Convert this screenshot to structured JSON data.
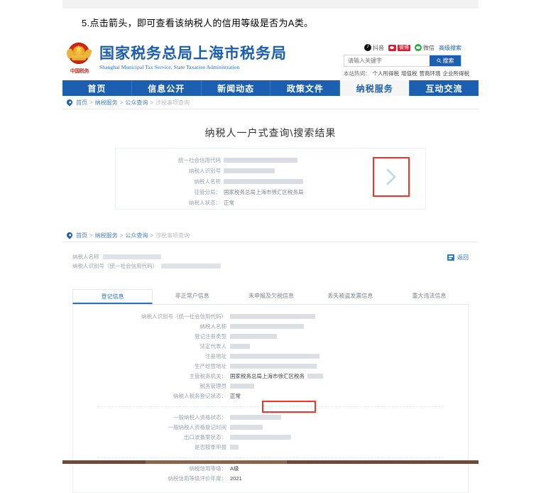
{
  "instruction": "5.点击箭头，即可查看该纳税人的信用等级是否为A类。",
  "site": {
    "title_cn": "国家税务总局上海市税务局",
    "title_en": "Shanghai Municipal Tax Service, State Taxation Administration",
    "emblem_mark": "中国税务"
  },
  "social": [
    {
      "label": "抖音",
      "icon": "douyin-icon"
    },
    {
      "label": "微博",
      "icon": "weibo-icon"
    },
    {
      "label": "微信",
      "icon": "weixin-icon"
    }
  ],
  "advanced_search": "高级搜索",
  "search": {
    "placeholder": "请输入关键字",
    "value": "",
    "button": "搜索",
    "icon": "search-icon"
  },
  "hotwords": {
    "prefix": "本站热词：",
    "items": [
      "个人所得税",
      "增值税",
      "营商环境",
      "企业所得税"
    ]
  },
  "nav": [
    {
      "label": "首页",
      "active": false
    },
    {
      "label": "信息公开",
      "active": false
    },
    {
      "label": "新闻动态",
      "active": false
    },
    {
      "label": "政策文件",
      "active": false
    },
    {
      "label": "纳税服务",
      "active": true
    },
    {
      "label": "互动交流",
      "active": false
    }
  ],
  "breadcrumb": {
    "items": [
      "首页",
      "纳税服务",
      "公众查询"
    ],
    "current": "涉税事项查询",
    "separator": ">"
  },
  "panel_a": {
    "card_title": "纳税人一户式查询\\搜索结果",
    "fields": [
      {
        "label": "统一社会信用代码",
        "value": "",
        "redacted": true,
        "redact_width": 104
      },
      {
        "label": "纳税人识别号",
        "value": "",
        "redacted": true,
        "redact_width": 72
      },
      {
        "label": "纳税人名称",
        "value": "",
        "redacted": true,
        "redact_width": 112
      },
      {
        "label": "征管分局：",
        "value": "国家税务总局上海市徐汇区税务局",
        "redacted": false
      },
      {
        "label": "纳税人状态：",
        "value": "正常",
        "redacted": false
      }
    ],
    "arrow_icon": "chevron-right-icon"
  },
  "panel_b": {
    "who": [
      {
        "label": "纳税人名称",
        "redact_width": 82
      },
      {
        "label": "纳税人识别号（统一社会信用代码）",
        "redact_width": 84
      }
    ],
    "back": {
      "label": "返回",
      "icon": "back-icon"
    },
    "tabs": [
      {
        "label": "登记信息",
        "active": true
      },
      {
        "label": "非正常户信息",
        "active": false
      },
      {
        "label": "未申报及欠税信息",
        "active": false
      },
      {
        "label": "丢失被盗发票信息",
        "active": false
      },
      {
        "label": "重大违法信息",
        "active": false
      }
    ],
    "details_top": [
      {
        "label": "纳税人识别号（统一社会信用代码）",
        "value": "",
        "redacted": true,
        "redact_width": 120
      },
      {
        "label": "纳税人名称",
        "value": "",
        "redacted": true,
        "redact_width": 104
      },
      {
        "label": "登记注册类型",
        "value": "",
        "redacted": true,
        "redact_width": 66
      },
      {
        "label": "法定代表人",
        "value": "",
        "redacted": true,
        "redact_width": 28
      },
      {
        "label": "注册地址",
        "value": "",
        "redacted": true,
        "redact_width": 126
      },
      {
        "label": "生产经营地址",
        "value": "",
        "redacted": true,
        "redact_width": 122
      },
      {
        "label": "主管税务机关：",
        "value": "国家税务总局上海市徐汇区税务",
        "redacted": false,
        "tail_redact": 22
      },
      {
        "label": "税务管理员",
        "value": "",
        "redacted": true,
        "redact_width": 34
      },
      {
        "label": "纳税人税务登记状态：",
        "value": "正常",
        "redacted": false
      }
    ],
    "details_mid": [
      {
        "label": "一般纳税人资格状态：",
        "value": "",
        "redacted": true,
        "redact_width": 72
      },
      {
        "label": "一般纳税人资格登记时间",
        "value": "",
        "redacted": true,
        "redact_width": 46
      },
      {
        "label": "出口波备案状态：",
        "value": "",
        "redacted": true,
        "redact_width": 86
      },
      {
        "label": "是否按季申报",
        "value": "",
        "redacted": true,
        "redact_width": 12
      }
    ],
    "details_credit": [
      {
        "label": "纳税信用等级：",
        "value": "A级",
        "highlight": true
      },
      {
        "label": "纳税信用等级评价年度：",
        "value": "2021",
        "highlight": false
      }
    ]
  },
  "colors": {
    "brand_blue": "#1c5fb0",
    "link_blue": "#2e6fc0",
    "highlight_red": "#ff2f22",
    "redact_gray": "#dcdfe4"
  }
}
